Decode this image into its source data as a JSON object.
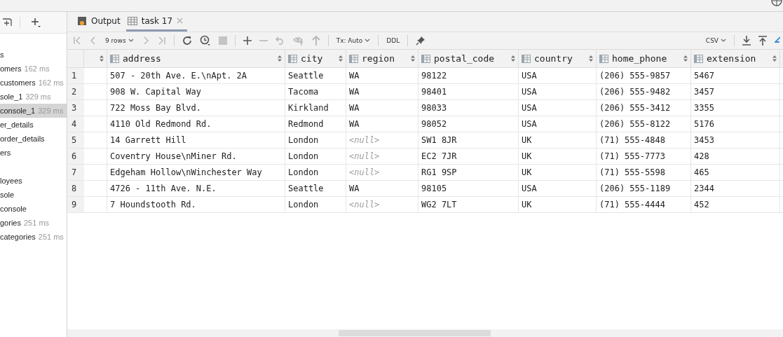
{
  "sidebar": {
    "groups": [
      [
        {
          "label": "s"
        },
        {
          "label": "omers",
          "time": "162 ms"
        },
        {
          "label": "customers",
          "time": "162 ms"
        },
        {
          "label": "sole_1",
          "time": "329 ms"
        },
        {
          "label": "console_1",
          "time": "329 ms",
          "selected": true
        },
        {
          "label": "er_details"
        },
        {
          "label": "order_details"
        },
        {
          "label": "ers"
        }
      ],
      [
        {
          "label": "loyees"
        },
        {
          "label": "sole"
        },
        {
          "label": "console"
        },
        {
          "label": "gories",
          "time": "251 ms"
        },
        {
          "label": "categories",
          "time": "251 ms"
        }
      ]
    ]
  },
  "tabs": [
    {
      "label": "Output",
      "kind": "output",
      "selected": false
    },
    {
      "label": "task 17",
      "kind": "table",
      "selected": true
    }
  ],
  "toolbar": {
    "rows": "9 rows",
    "tx": "Tx: Auto",
    "ddl": "DDL",
    "format": "CSV"
  },
  "table": {
    "columns": [
      "address",
      "city",
      "region",
      "postal_code",
      "country",
      "home_phone",
      "extension"
    ],
    "rows": [
      {
        "num": "1",
        "cells": [
          "507 - 20th Ave. E.\\nApt. 2A",
          "Seattle",
          "WA",
          "98122",
          "USA",
          "(206) 555-9857",
          "5467"
        ]
      },
      {
        "num": "2",
        "cells": [
          "908 W. Capital Way",
          "Tacoma",
          "WA",
          "98401",
          "USA",
          "(206) 555-9482",
          "3457"
        ]
      },
      {
        "num": "3",
        "cells": [
          "722 Moss Bay Blvd.",
          "Kirkland",
          "WA",
          "98033",
          "USA",
          "(206) 555-3412",
          "3355"
        ]
      },
      {
        "num": "4",
        "cells": [
          "4110 Old Redmond Rd.",
          "Redmond",
          "WA",
          "98052",
          "USA",
          "(206) 555-8122",
          "5176"
        ]
      },
      {
        "num": "5",
        "cells": [
          "14 Garrett Hill",
          "London",
          {
            "text": "<null>",
            "kind": "null"
          },
          "SW1 8JR",
          "UK",
          "(71) 555-4848",
          "3453"
        ]
      },
      {
        "num": "6",
        "cells": [
          "Coventry House\\nMiner Rd.",
          "London",
          {
            "text": "<null>",
            "kind": "null"
          },
          "EC2 7JR",
          "UK",
          "(71) 555-7773",
          "428"
        ]
      },
      {
        "num": "7",
        "cells": [
          "Edgeham Hollow\\nWinchester Way",
          "London",
          {
            "text": "<null>",
            "kind": "null"
          },
          "RG1 9SP",
          "UK",
          "(71) 555-5598",
          "465"
        ]
      },
      {
        "num": "8",
        "cells": [
          "4726 - 11th Ave. N.E.",
          "Seattle",
          "WA",
          "98105",
          "USA",
          "(206) 555-1189",
          "2344"
        ]
      },
      {
        "num": "9",
        "cells": [
          "7 Houndstooth Rd.",
          "London",
          {
            "text": "<null>",
            "kind": "null"
          },
          "WG2 7LT",
          "UK",
          "(71) 555-4444",
          "452"
        ]
      }
    ]
  }
}
